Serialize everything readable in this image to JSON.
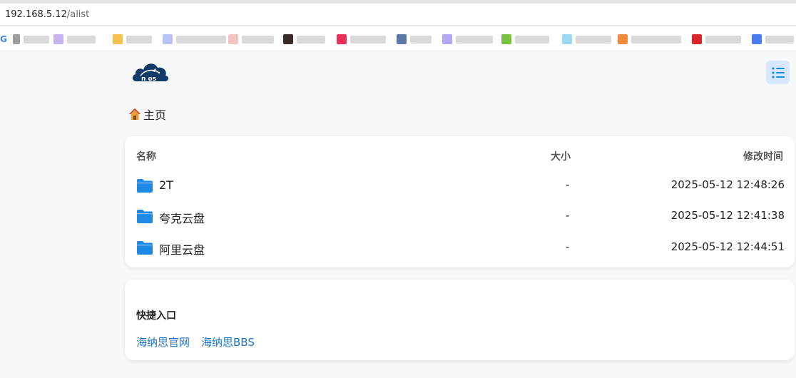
{
  "browser": {
    "url_host": "192.168.5.12",
    "url_path": "/alist"
  },
  "bookmarks": [
    {
      "icon": "bookmark-favicon",
      "color": "#9e9e9e"
    },
    {
      "icon": "bookmark-favicon",
      "color": "#c7b3f0"
    },
    {
      "icon": "bookmark-favicon",
      "color": "#f2c14e"
    },
    {
      "icon": "bookmark-favicon",
      "color": "#b8c4f7"
    },
    {
      "icon": "bookmark-favicon",
      "color": "#f3c4c4"
    },
    {
      "icon": "bookmark-favicon",
      "color": "#3a2a2a"
    },
    {
      "icon": "bookmark-favicon",
      "color": "#e8315c"
    },
    {
      "icon": "bookmark-favicon",
      "color": "#5a79a8"
    },
    {
      "icon": "bookmark-favicon",
      "color": "#b3a8f0"
    },
    {
      "icon": "bookmark-favicon",
      "color": "#7ac142"
    },
    {
      "icon": "bookmark-favicon",
      "color": "#9ad8f0"
    },
    {
      "icon": "bookmark-favicon",
      "color": "#f08a3a"
    },
    {
      "icon": "bookmark-favicon",
      "color": "#d9262c"
    },
    {
      "icon": "bookmark-favicon",
      "color": "#4a7cf0"
    }
  ],
  "logo": {
    "text": "n os",
    "color": "#0f3b66"
  },
  "breadcrumb": {
    "home_label": "主页"
  },
  "table": {
    "headers": {
      "name": "名称",
      "size": "大小",
      "modified": "修改时间"
    },
    "rows": [
      {
        "name": "2T",
        "size": "-",
        "modified": "2025-05-12 12:48:26"
      },
      {
        "name": "夸克云盘",
        "size": "-",
        "modified": "2025-05-12 12:41:38"
      },
      {
        "name": "阿里云盘",
        "size": "-",
        "modified": "2025-05-12 12:44:51"
      }
    ]
  },
  "quick_access": {
    "title": "快捷入口",
    "links": [
      "海纳思官网",
      "海纳思BBS"
    ]
  },
  "colors": {
    "accent": "#1a73c8",
    "folder": "#1e88e5",
    "menu_bg": "#d6e8ff"
  }
}
